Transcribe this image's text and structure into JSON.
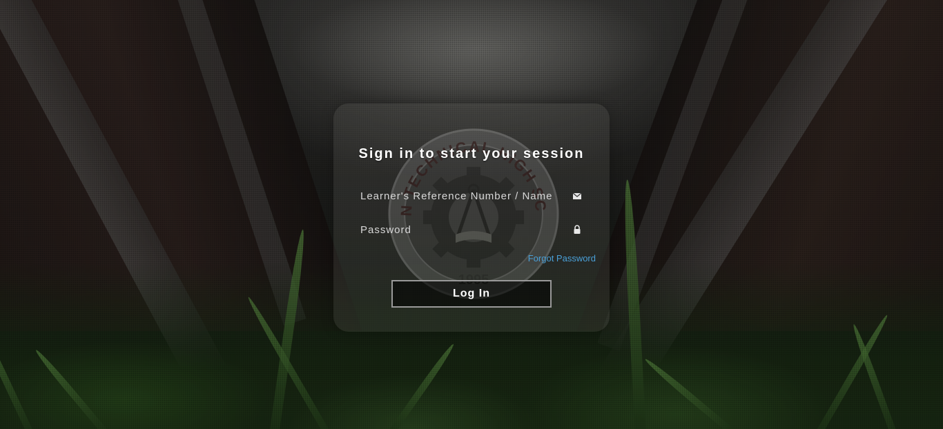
{
  "login": {
    "title": "Sign in to start your session",
    "username_placeholder": "Learner's Reference Number / Name",
    "password_placeholder": "Password",
    "forgot_password_label": "Forgot Password",
    "login_button_label": "Log In"
  },
  "seal": {
    "text": "BAYAN TECHNICAL HIGH SCHOOL",
    "year": "1995"
  },
  "icons": {
    "username": "envelope-icon",
    "password": "lock-icon"
  },
  "colors": {
    "link": "#4aa0d8",
    "button_border": "#9a9a9a"
  }
}
